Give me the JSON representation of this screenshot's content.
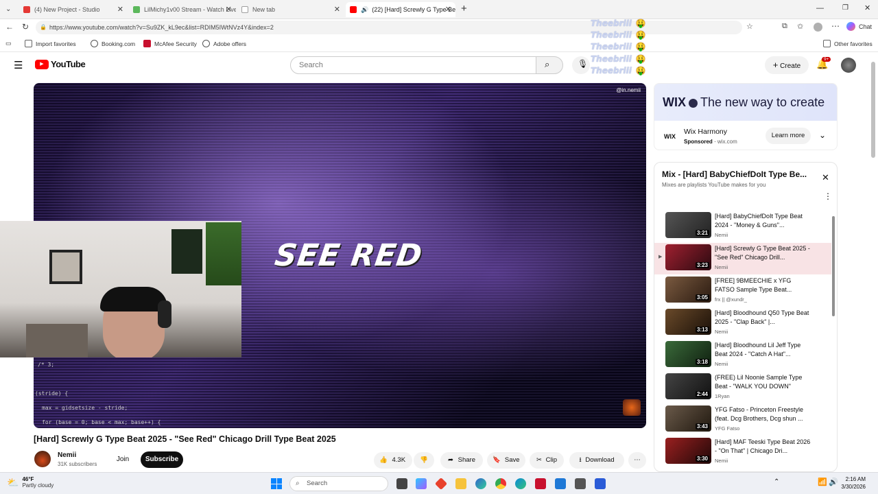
{
  "browser": {
    "tabs": [
      {
        "label": "(4) New Project - Studio",
        "color": "#e53935"
      },
      {
        "label": "LilMichy1v00 Stream - Watch Live",
        "color": "#5cb85c"
      },
      {
        "label": "New tab",
        "color": "#9e9e9e"
      },
      {
        "label": "(22) [Hard] Screwly G Type Be",
        "color": "#ff0000"
      }
    ],
    "new_tab": "+",
    "url": "https://www.youtube.com/watch?v=Su9ZK_kL9ec&list=RDIM5IWtNVz4Y&index=2",
    "chat_label": "Chat",
    "favorites": [
      "Import favorites",
      "Booking.com",
      "McAfee Security",
      "Adobe offers"
    ],
    "other_favorites": "Other favorites"
  },
  "overlay": {
    "lines": [
      "Theebriii",
      "Theebriii",
      "Theebriii",
      "Theebriii",
      "Theebriii"
    ],
    "emoji": "🤑"
  },
  "youtube": {
    "logo_text": "YouTube",
    "search_placeholder": "Search",
    "create_label": "Create",
    "notif_count": "9+"
  },
  "video": {
    "overlay_text": "SEE RED",
    "watermark": "@in.nemii",
    "code_lines": [
      "/* 3;",
      "(stride) {",
      "max = gidsetsize - stride;",
      "for (base = 0; base < max; base++) {"
    ],
    "title": "[Hard] Screwly G Type Beat 2025 - \"See Red\" Chicago Drill Type Beat 2025",
    "channel": "Nemii",
    "subscribers": "31K subscribers",
    "join": "Join",
    "subscribe": "Subscribe",
    "likes": "4.3K",
    "share": "Share",
    "save": "Save",
    "clip": "Clip",
    "download": "Download"
  },
  "ad": {
    "brand": "WIX",
    "tagline": "The new way to create",
    "advertiser": "Wix Harmony",
    "sponsored": "Sponsored",
    "domain": "wix.com",
    "cta": "Learn more"
  },
  "mix": {
    "title": "Mix - [Hard] BabyChiefDoIt Type Be...",
    "subtitle": "Mixes are playlists YouTube makes for you",
    "items": [
      {
        "title": "[Hard] BabyChiefDoIt Type Beat 2024 - \"Money & Guns\"...",
        "channel": "Nemii",
        "duration": "3:21",
        "thumb": "#3a3a3a"
      },
      {
        "title": "[Hard] Screwly G Type Beat 2025 - \"See Red\" Chicago Drill...",
        "channel": "Nemii",
        "duration": "3:23",
        "thumb": "#7a2030"
      },
      {
        "title": "[FREE] 9BMEECHIE x YFG FATSO Sample Type Beat...",
        "channel": "frx || @xundr_",
        "duration": "3:05",
        "thumb": "#5a3a2a"
      },
      {
        "title": "[Hard] Bloodhound Q50 Type Beat 2025 - \"Clap Back\" |...",
        "channel": "Nemii",
        "duration": "3:13",
        "thumb": "#3a2a1a"
      },
      {
        "title": "[Hard] Bloodhound Lil Jeff Type Beat 2024 - \"Catch A Hat\"...",
        "channel": "Nemii",
        "duration": "3:18",
        "thumb": "#2a4a2a"
      },
      {
        "title": "(FREE) Lil Noonie Sample Type Beat - \"WALK YOU DOWN\"",
        "channel": "1Ryan",
        "duration": "2:44",
        "thumb": "#2a2a2a"
      },
      {
        "title": "YFG Fatso - Princeton Freestyle (feat. Dcg Brothers, Dcg shun ...",
        "channel": "YFG Fatso",
        "duration": "3:43",
        "thumb": "#4a3a30"
      },
      {
        "title": "[Hard] MAF Teeski Type Beat 2026 - \"On That\" | Chicago Dri...",
        "channel": "Nemii",
        "duration": "3:30",
        "thumb": "#6a1a1a"
      }
    ]
  },
  "taskbar": {
    "weather_temp": "46°F",
    "weather_desc": "Partly cloudy",
    "search": "Search",
    "time": "2:16 AM",
    "date": "3/30/2026"
  }
}
